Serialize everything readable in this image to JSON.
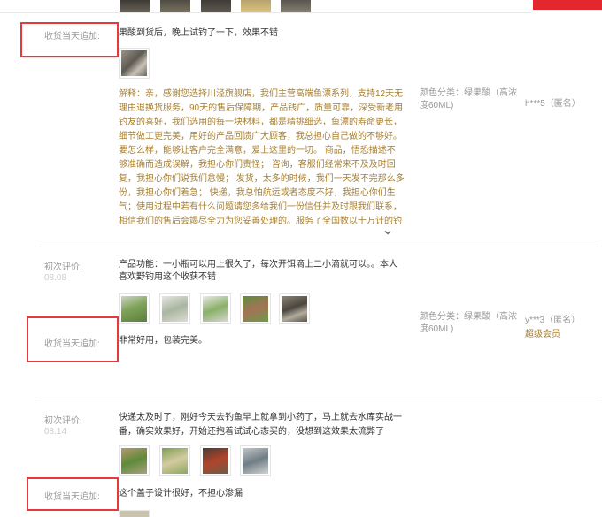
{
  "top_bar": {
    "accent_color": "#e4262d"
  },
  "review1": {
    "append_label": "收货当天追加:",
    "append_text": "果酸到货后，晚上试钓了一下，效果不错",
    "reply_lines": [
      "解释：亲，感谢您选择川泾旗舰店，我们主营高端鱼漂系列，支持12天无",
      "理由退换货服务，90天的售后保障期，产品钱广，质量可靠，深受新老用",
      "钓友的喜好，我们选用的每一块材料，都是精挑细选，鱼漂的寿命更长，",
      "细节做工更完美，用好的产品回馈广大顾客，我总担心自己做的不够好。",
      "要怎么样，能够让客户完全满意，爱上这里的一切。 商品，悟恐描述不",
      "够准确而造成误解，我担心你们责怪；  咨询，客服们经常来不及及时回",
      "复，我担心你们说我们怠慢；  发货，太多的时候，我们一天发不完那么多",
      "份，我担心你们着急；  快递，我总怕航运或者态度不好，我担心你们生",
      "气；使用过程中若有什么问题请您多给我们一份信任并及时跟我们联系，",
      "相信我们的售后会竭尽全力为您妥善处理的。服务了全国数以十万计的钓"
    ],
    "sku_lines": [
      "颜色分类：绿果酸（高浓",
      "度60ML)"
    ],
    "user": "h***5（匿名）"
  },
  "review2": {
    "first_label": "初次评价:",
    "first_date": "08.08",
    "text_lines": [
      "产品功能：一小瓶可以用上很久了，每次开饵滴上二小滴就可以。。本人",
      "喜欢野钓用这个收获不错"
    ],
    "append_label": "收货当天追加:",
    "append_text": "非常好用，包装完美。",
    "sku_lines": [
      "颜色分类：绿果酸（高浓",
      "度60ML)"
    ],
    "user": "y***3（匿名）",
    "vip": "超级会员"
  },
  "review3": {
    "first_label": "初次评价:",
    "first_date": "08.14",
    "text_lines": [
      "快递太及时了，刚好今天去钓鱼早上就拿到小药了，马上就去水库实战一",
      "番，确实效果好，开始还抱着试试心态买的，没想到这效果太流弊了"
    ],
    "append_label": "收货当天追加:",
    "append_text": "这个盖子设计很好，不担心渗漏"
  }
}
